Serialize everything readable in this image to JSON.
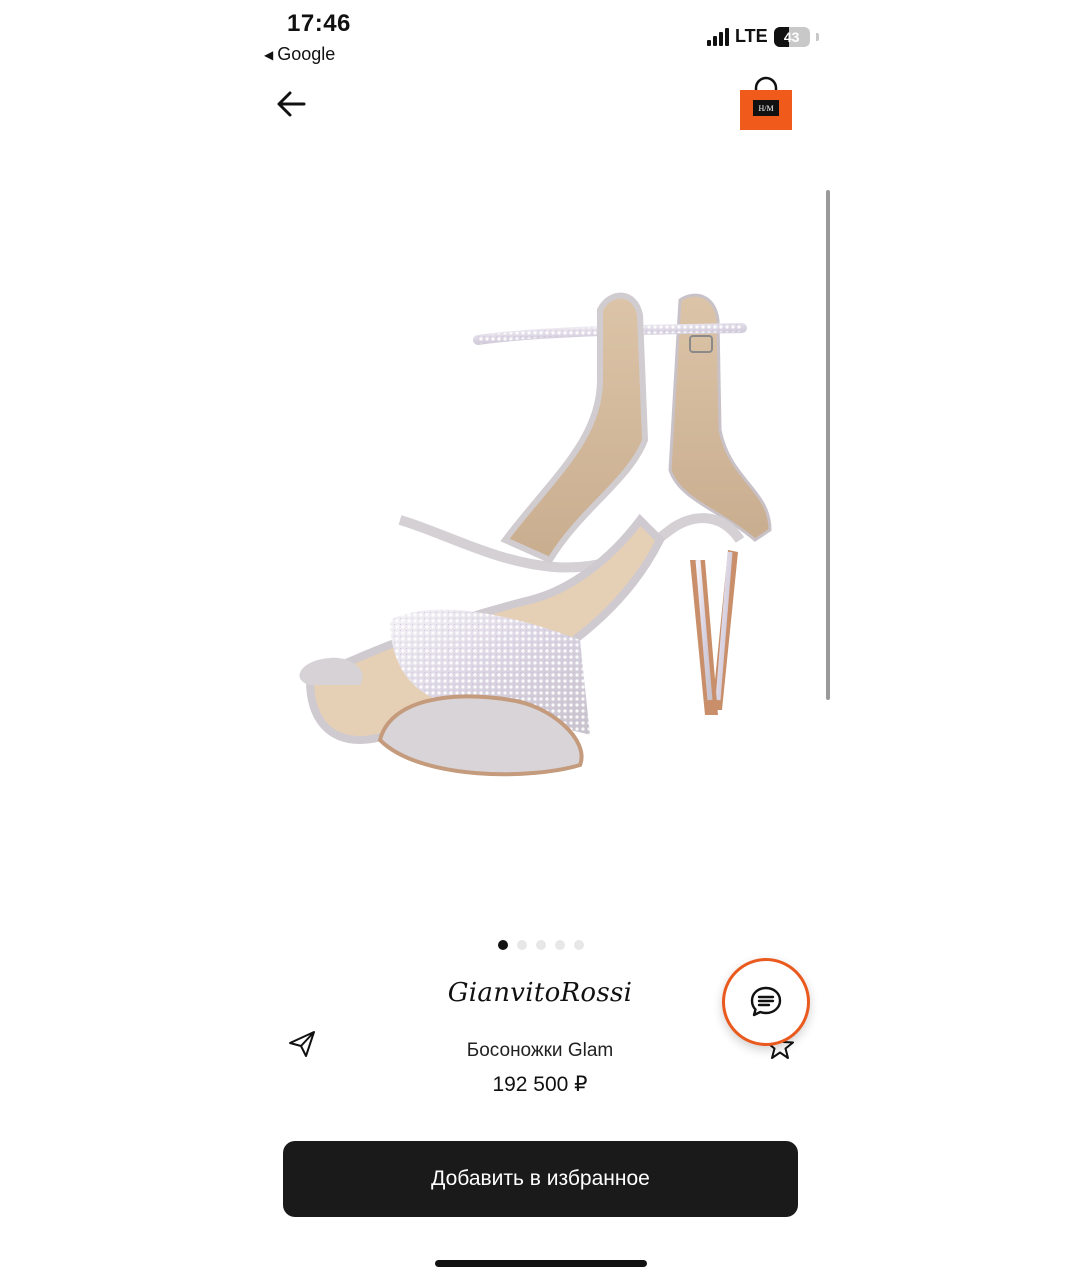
{
  "status_bar": {
    "time": "17:46",
    "back_app": "Google",
    "network": "LTE",
    "battery": "43",
    "battery_level": 0.43
  },
  "header": {
    "back_icon": "arrow-left-icon",
    "shop_icon": "shopping-bag-icon",
    "shop_logo_text": "H/M",
    "accent_color": "#f05a1a"
  },
  "gallery": {
    "image_count": 5,
    "active_index": 0
  },
  "product": {
    "brand": "GianvitoRossi",
    "title": "Босоножки Glam",
    "price": "192 500 ₽"
  },
  "actions": {
    "share_icon": "send-icon",
    "favorite_icon": "star-outline-icon",
    "chat_icon": "chat-icon",
    "add_favorite_label": "Добавить в избранное"
  }
}
